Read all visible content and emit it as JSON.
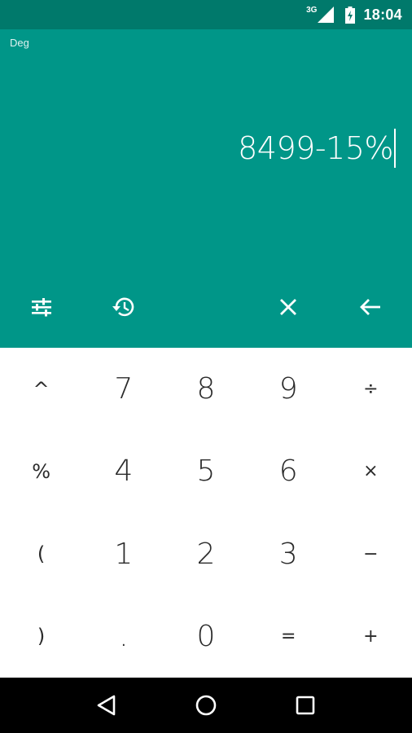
{
  "status_bar": {
    "network": "3G",
    "time": "18:04"
  },
  "display": {
    "angle_mode": "Deg",
    "expression": "8499-15%"
  },
  "toolbar": {
    "icons": [
      "settings-sliders-icon",
      "history-icon",
      "clear-icon",
      "backspace-icon"
    ]
  },
  "keypad": {
    "rows": [
      [
        "^",
        "7",
        "8",
        "9",
        "÷"
      ],
      [
        "%",
        "4",
        "5",
        "6",
        "×"
      ],
      [
        "(",
        "1",
        "2",
        "3",
        "−"
      ],
      [
        ")",
        ".",
        "0",
        "=",
        "+"
      ]
    ]
  },
  "nav_bar": {
    "icons": [
      "back-icon",
      "home-icon",
      "recents-icon"
    ]
  },
  "colors": {
    "status_bar": "#00796b",
    "display_bg": "#009688",
    "keypad_bg": "#ffffff",
    "nav_bar": "#000000"
  }
}
